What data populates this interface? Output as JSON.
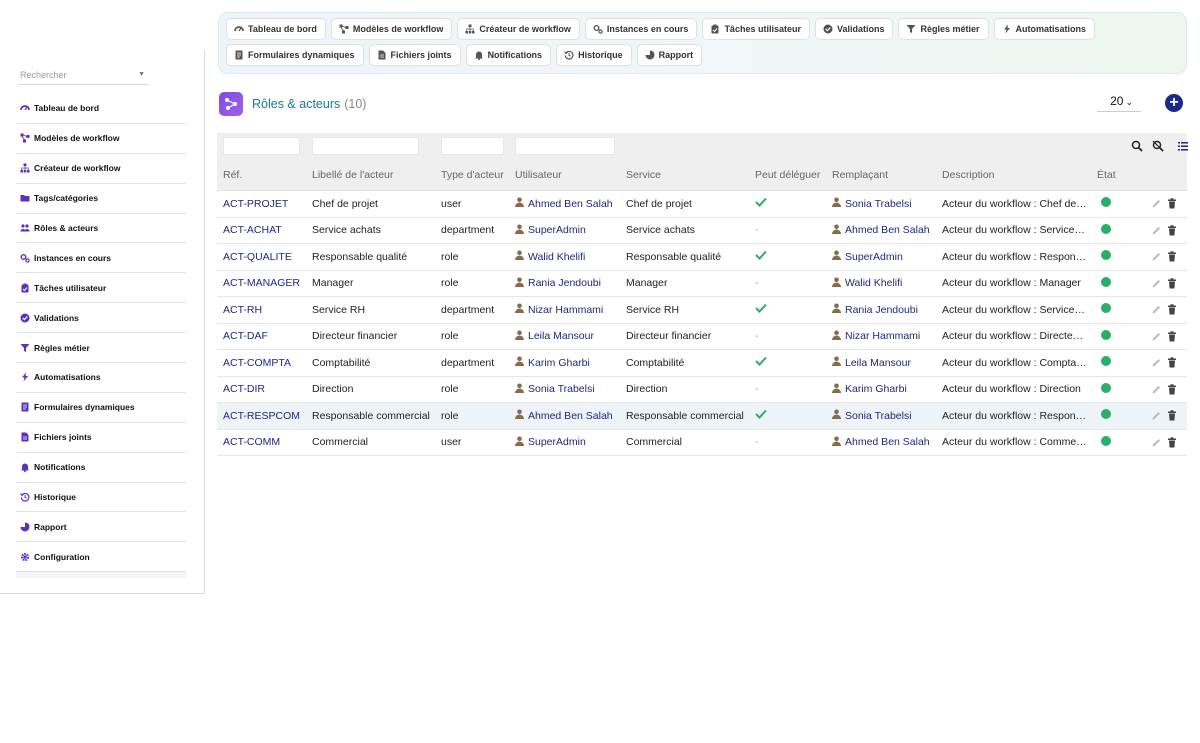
{
  "topmenu": {
    "row1": [
      {
        "label": "Tableau de bord",
        "icon": "dashboard-icon"
      },
      {
        "label": "Modèles de workflow",
        "icon": "workflow-models-icon"
      },
      {
        "label": "Créateur de workflow",
        "icon": "sitemap-icon"
      },
      {
        "label": "Instances en cours",
        "icon": "gears-icon"
      },
      {
        "label": "Tâches utilisateur",
        "icon": "clipboard-icon"
      },
      {
        "label": "Validations",
        "icon": "check-circle-icon"
      },
      {
        "label": "Règles métier",
        "icon": "filter-icon"
      },
      {
        "label": "Automatisations",
        "icon": "bolt-icon"
      }
    ],
    "row2": [
      {
        "label": "Formulaires dynamiques",
        "icon": "form-icon"
      },
      {
        "label": "Fichiers joints",
        "icon": "file-icon"
      },
      {
        "label": "Notifications",
        "icon": "bell-icon"
      },
      {
        "label": "Historique",
        "icon": "history-icon"
      },
      {
        "label": "Rapport",
        "icon": "pie-chart-icon"
      }
    ]
  },
  "sidebar": {
    "search_placeholder": "Rechercher",
    "items": [
      {
        "label": "Tableau de bord",
        "icon": "dashboard-icon"
      },
      {
        "label": "Modèles de workflow",
        "icon": "workflow-models-icon"
      },
      {
        "label": "Créateur de workflow",
        "icon": "sitemap-icon"
      },
      {
        "label": "Tags/catégories",
        "icon": "folder-icon"
      },
      {
        "label": "Rôles & acteurs",
        "icon": "users-icon"
      },
      {
        "label": "Instances en cours",
        "icon": "gears-icon"
      },
      {
        "label": "Tâches utilisateur",
        "icon": "clipboard-icon"
      },
      {
        "label": "Validations",
        "icon": "check-circle-icon"
      },
      {
        "label": "Règles métier",
        "icon": "filter-icon"
      },
      {
        "label": "Automatisations",
        "icon": "bolt-icon"
      },
      {
        "label": "Formulaires dynamiques",
        "icon": "form-icon"
      },
      {
        "label": "Fichiers joints",
        "icon": "file-icon"
      },
      {
        "label": "Notifications",
        "icon": "bell-icon"
      },
      {
        "label": "Historique",
        "icon": "history-icon"
      },
      {
        "label": "Rapport",
        "icon": "pie-chart-icon"
      },
      {
        "label": "Configuration",
        "icon": "gear-icon"
      }
    ]
  },
  "page": {
    "title": "Rôles & acteurs",
    "count": "(10)",
    "page_size": "20"
  },
  "table": {
    "headers": [
      "Réf.",
      "Libellé de l'acteur",
      "Type d'acteur",
      "Utilisateur",
      "Service",
      "Peut déléguer",
      "Remplaçant",
      "Description",
      "État"
    ],
    "rows": [
      {
        "ref": "ACT-PROJET",
        "label": "Chef de projet",
        "type": "user",
        "user": "Ahmed Ben Salah",
        "service": "Chef de projet",
        "delegate": true,
        "replacement": "Sonia Trabelsi",
        "description": "Acteur du workflow : Chef de projet"
      },
      {
        "ref": "ACT-ACHAT",
        "label": "Service achats",
        "type": "department",
        "user": "SuperAdmin",
        "service": "Service achats",
        "delegate": false,
        "replacement": "Ahmed Ben Salah",
        "description": "Acteur du workflow : Service achats"
      },
      {
        "ref": "ACT-QUALITE",
        "label": "Responsable qualité",
        "type": "role",
        "user": "Walid Khelifi",
        "service": "Responsable qualité",
        "delegate": true,
        "replacement": "SuperAdmin",
        "description": "Acteur du workflow : Responsable qualité"
      },
      {
        "ref": "ACT-MANAGER",
        "label": "Manager",
        "type": "role",
        "user": "Rania Jendoubi",
        "service": "Manager",
        "delegate": false,
        "replacement": "Walid Khelifi",
        "description": "Acteur du workflow : Manager"
      },
      {
        "ref": "ACT-RH",
        "label": "Service RH",
        "type": "department",
        "user": "Nizar Hammami",
        "service": "Service RH",
        "delegate": true,
        "replacement": "Rania Jendoubi",
        "description": "Acteur du workflow : Service RH"
      },
      {
        "ref": "ACT-DAF",
        "label": "Directeur financier",
        "type": "role",
        "user": "Leila Mansour",
        "service": "Directeur financier",
        "delegate": false,
        "replacement": "Nizar Hammami",
        "description": "Acteur du workflow : Directeur financier"
      },
      {
        "ref": "ACT-COMPTA",
        "label": "Comptabilité",
        "type": "department",
        "user": "Karim Gharbi",
        "service": "Comptabilité",
        "delegate": true,
        "replacement": "Leila Mansour",
        "description": "Acteur du workflow : Comptabilité"
      },
      {
        "ref": "ACT-DIR",
        "label": "Direction",
        "type": "role",
        "user": "Sonia Trabelsi",
        "service": "Direction",
        "delegate": false,
        "replacement": "Karim Gharbi",
        "description": "Acteur du workflow : Direction"
      },
      {
        "ref": "ACT-RESPCOM",
        "label": "Responsable commercial",
        "type": "role",
        "user": "Ahmed Ben Salah",
        "service": "Responsable commercial",
        "delegate": true,
        "replacement": "Sonia Trabelsi",
        "description": "Acteur du workflow : Responsable commercial"
      },
      {
        "ref": "ACT-COMM",
        "label": "Commercial",
        "type": "user",
        "user": "SuperAdmin",
        "service": "Commercial",
        "delegate": false,
        "replacement": "Ahmed Ben Salah",
        "description": "Acteur du workflow : Commercial"
      }
    ],
    "no_delegate_mark": "-",
    "highlighted_row": 8
  },
  "colors": {
    "accent": "#7b4fe0",
    "link": "#1b2a7c",
    "title": "#1a7a8c",
    "status_active": "#2bae66",
    "check": "#2bae66"
  }
}
